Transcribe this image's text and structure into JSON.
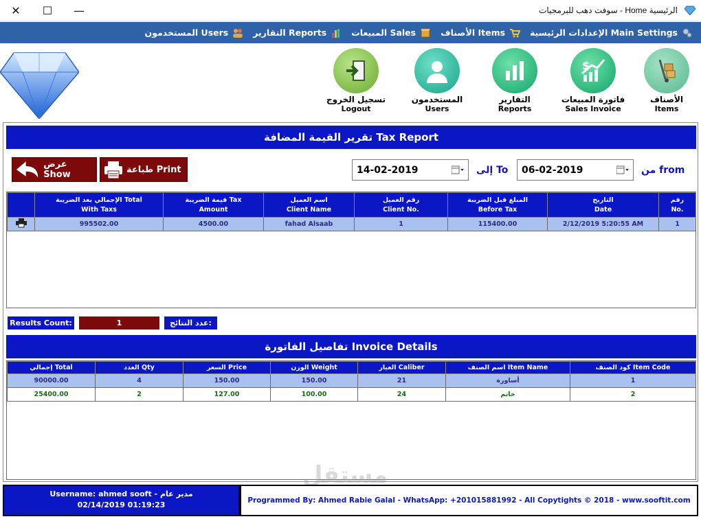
{
  "window": {
    "title": "الرئيسية Home - سوفت دهب للبرمجيات",
    "close_glyph": "✕",
    "maximize_glyph": "☐",
    "minimize_glyph": "—"
  },
  "menu": [
    {
      "label": "الإعدادات الرئيسية Main Settings",
      "icon": "gear-icon"
    },
    {
      "label": "الأصناف Items",
      "icon": "cart-icon"
    },
    {
      "label": "المبيعات Sales",
      "icon": "box-icon"
    },
    {
      "label": "التقارير Reports",
      "icon": "chart-icon"
    },
    {
      "label": "المستخدمون Users",
      "icon": "users-icon"
    }
  ],
  "toolbar": {
    "items": {
      "ar": "الأصناف",
      "en": "Items"
    },
    "sales_invoice": {
      "ar": "فاتورة المبيعات",
      "en": "Sales Invoice"
    },
    "reports": {
      "ar": "التقارير",
      "en": "Reports"
    },
    "users": {
      "ar": "المستخدمون",
      "en": "Users"
    },
    "logout": {
      "ar": "تسجيل الخروج",
      "en": "Logout"
    }
  },
  "report": {
    "title": "تقرير القيمة المضافة Tax Report",
    "from_label": "من  from",
    "to_label": "إلى  To",
    "from_date": "06-02-2019",
    "to_date": "14-02-2019",
    "print_label": "طباعة Print",
    "show_label": "عرض Show",
    "columns": [
      {
        "ar": "رقم",
        "en": "No."
      },
      {
        "ar": "التاريخ",
        "en": "Date"
      },
      {
        "ar": "المبلغ قبل الضريبة",
        "en": "Before Tax"
      },
      {
        "ar": "رقم العميل",
        "en": "Client No."
      },
      {
        "ar": "اسم العميل",
        "en": "Client Name"
      },
      {
        "ar": "قيمة الضريبة Tax",
        "en": "Amount"
      },
      {
        "ar": "الإجمالي بعد الضريبة Total",
        "en": "With Taxs"
      }
    ],
    "rows": [
      {
        "no": "1",
        "date": "2/12/2019 5:20:55 AM",
        "before_tax": "115400.00",
        "client_no": "1",
        "client_name": "fahad Alsaab",
        "tax": "4500.00",
        "total": "995502.00"
      }
    ],
    "results_count_en": "Results Count:",
    "results_count_value": "1",
    "results_count_ar": "عدد النتائج:"
  },
  "invoice": {
    "title": "تفاصيل الفاتورة Invoice Details",
    "columns": [
      "كود الصنف Item Code",
      "اسم الصنف Item Name",
      "العيار Caliber",
      "الوزن Weight",
      "السعر Price",
      "العدد Qty",
      "إجمالي Total"
    ],
    "rows": [
      {
        "code": "1",
        "name": "أساورة",
        "caliber": "21",
        "weight": "150.00",
        "price": "150.00",
        "qty": "4",
        "total": "90000.00"
      },
      {
        "code": "2",
        "name": "خاتم",
        "caliber": "24",
        "weight": "100.00",
        "price": "127.00",
        "qty": "2",
        "total": "25400.00"
      }
    ]
  },
  "footer": {
    "user_line": "Username: ahmed sooft - مدير عام",
    "datetime": "02/14/2019 01:19:23",
    "credits": "Programmed By: Ahmed Rabie Galal - WhatsApp: +201015881992 - All Copytights © 2018 - www.sooftit.com"
  },
  "watermark": "مستقل",
  "colors": {
    "menu_blue": "#2f62a6",
    "header_blue": "#0b17c4",
    "button_red": "#7c0a0a",
    "selected_row": "#a8c1ee"
  }
}
